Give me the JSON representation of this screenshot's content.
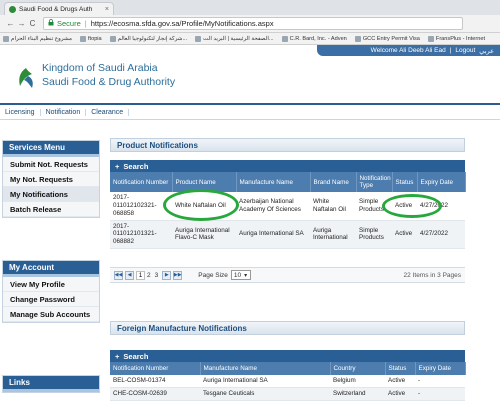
{
  "browser": {
    "tab_title": "Saudi Food & Drugs Auth",
    "tab_close": "×",
    "nav_back": "←",
    "nav_forward": "→",
    "nav_reload": "C",
    "secure_label": "Secure",
    "url_separator": "|",
    "url": "https://ecosma.sfda.gov.sa/Profile/MyNotifications.aspx",
    "bookmarks": [
      "مشروع تنظيم البناء الحرام",
      "ftopia",
      "شركة إنجاز لتكنولوجيا العالم...",
      "الصفحة الرئيسية | البريد الت...",
      "C.R. Bard, Inc. - Adven",
      "GCC Entry Permit Visa",
      "FransPlus - Internet"
    ]
  },
  "header": {
    "title_line1": "Kingdom of Saudi Arabia",
    "title_line2": "Saudi Food & Drug Authority",
    "welcome": "Welcome Ali Deeb Ali Ead",
    "logout": "Logout",
    "arabic": "عربي",
    "separator": "|"
  },
  "topnav": [
    "Licensing",
    "Notification",
    "Clearance"
  ],
  "sidebar": {
    "services": {
      "title": "Services Menu",
      "items": [
        "Submit Not. Requests",
        "My Not. Requests",
        "My Notifications",
        "Batch Release"
      ],
      "active_index": 2
    },
    "account": {
      "title": "My Account",
      "items": [
        "View My Profile",
        "Change Password",
        "Manage Sub Accounts"
      ]
    },
    "links": {
      "title": "Links"
    }
  },
  "product_notifications": {
    "section_title": "Product Notifications",
    "grid_title": "Search",
    "plus": "+",
    "columns": [
      "Notification Number",
      "Product Name",
      "Manufacture Name",
      "Brand Name",
      "Notification Type",
      "Status",
      "Expiry Date"
    ],
    "rows": [
      [
        "2017-011012102321-068858",
        "White Naftalan Oil",
        "Azerbaijan National Academy Of Sciences",
        "White Naftalan Oil",
        "Simple Products",
        "Active",
        "4/27/2022"
      ],
      [
        "2017-011012101321-068882",
        "Auriga International Flavo-C Mask",
        "Auriga International SA",
        "Auriga International",
        "Simple Products",
        "Active",
        "4/27/2022"
      ]
    ],
    "pager": {
      "first": "◀◀",
      "prev": "◀",
      "pages": [
        "1",
        "2",
        "3"
      ],
      "current": "1",
      "next": "▶",
      "last": "▶▶",
      "page_size_label": "Page Size",
      "page_size": "10",
      "page_size_caret": "▾",
      "info": "22 Items in 3 Pages"
    }
  },
  "foreign_notifications": {
    "section_title": "Foreign Manufacture Notifications",
    "grid_title": "Search",
    "plus": "+",
    "columns": [
      "Notification Number",
      "Manufacture Name",
      "Country",
      "Status",
      "Expiry Date"
    ],
    "rows": [
      [
        "BEL-COSM-01374",
        "Auriga International SA",
        "Belgium",
        "Active",
        "-"
      ],
      [
        "CHE-COSM-02639",
        "Tesgane Ceuticals",
        "Switzerland",
        "Active",
        "-"
      ]
    ]
  },
  "colors": {
    "header_blue": "#2a5f96",
    "highlight_green": "#28a83c",
    "brand_text": "#2d6e9b"
  }
}
